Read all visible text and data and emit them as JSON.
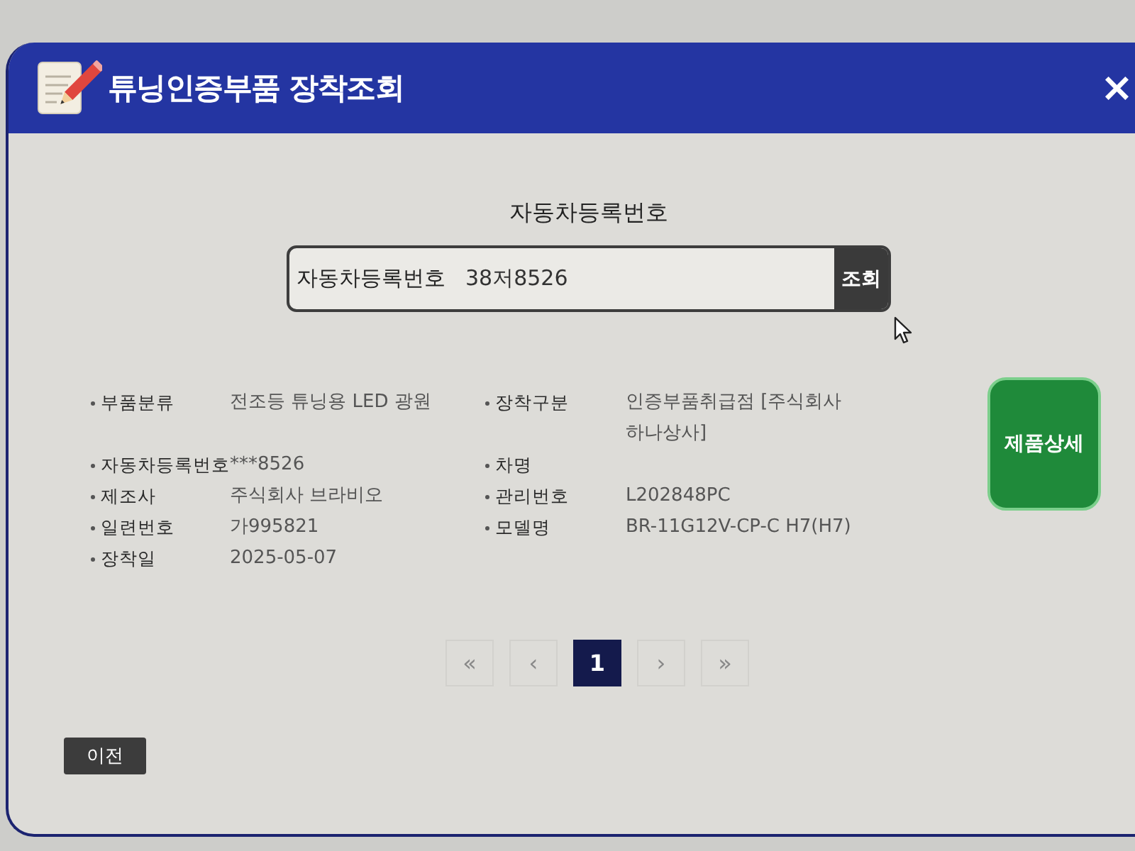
{
  "window": {
    "title": "튜닝인증부품 장착조회",
    "close": "×"
  },
  "search": {
    "heading": "자동차등록번호",
    "label": "자동차등록번호",
    "value": "38저8526",
    "button": "조회"
  },
  "details": {
    "rows": [
      [
        {
          "label": "부품분류",
          "value": "전조등 튜닝용 LED 광원"
        },
        {
          "label": "장착구분",
          "value": "인증부품취급점 [주식회사 하나상사]"
        }
      ],
      [
        {
          "label": "자동차등록번호",
          "value": "***8526"
        },
        {
          "label": "차명"
        }
      ],
      [
        {
          "label": "제조사",
          "value": "주식회사 브라비오"
        },
        {
          "label": "관리번호",
          "value": "L202848PC"
        }
      ],
      [
        {
          "label": "일련번호",
          "value": "가995821"
        },
        {
          "label": "모델명",
          "value": "BR-11G12V-CP-C H7(H7)"
        }
      ],
      [
        {
          "label": "장착일",
          "value": "2025-05-07"
        }
      ]
    ]
  },
  "detail_button": "제품상세",
  "pagination": [
    {
      "label": "«",
      "selected": false
    },
    {
      "label": "‹",
      "selected": false
    },
    {
      "label": "1",
      "selected": true
    },
    {
      "label": "›",
      "selected": false
    },
    {
      "label": "»",
      "selected": false
    }
  ],
  "back_button": "이전"
}
